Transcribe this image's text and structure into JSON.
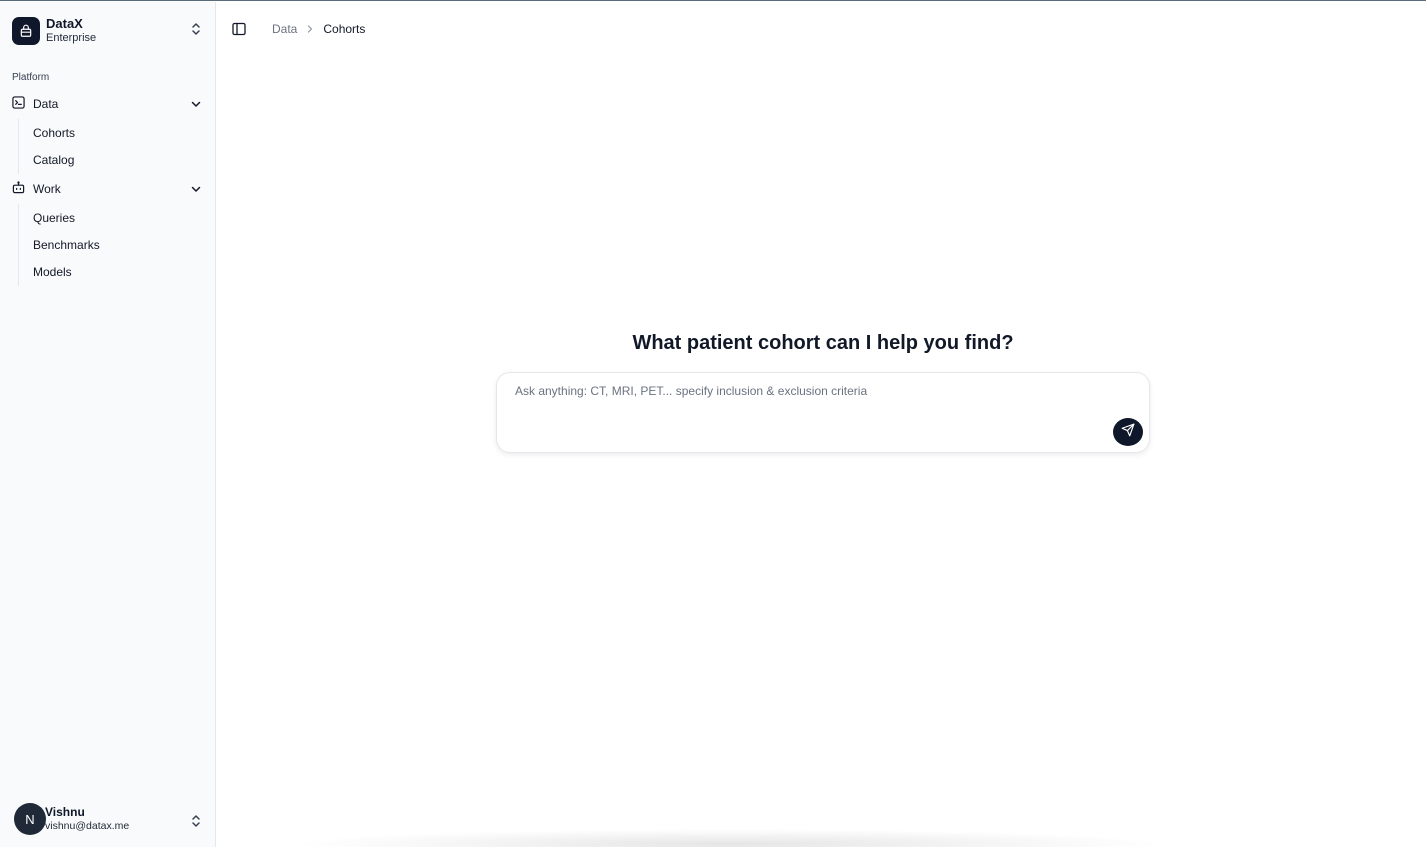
{
  "brand": {
    "name": "DataX",
    "plan": "Enterprise"
  },
  "sidebar": {
    "section_label": "Platform",
    "groups": [
      {
        "label": "Data",
        "icon": "chart-square-icon",
        "items": [
          "Cohorts",
          "Catalog"
        ]
      },
      {
        "label": "Work",
        "icon": "bot-icon",
        "items": [
          "Queries",
          "Benchmarks",
          "Models"
        ]
      }
    ]
  },
  "user": {
    "initial": "N",
    "name": "Vishnu",
    "email": "vishnu@datax.me"
  },
  "breadcrumb": {
    "parent": "Data",
    "current": "Cohorts"
  },
  "main": {
    "title": "What patient cohort can I help you find?",
    "input_placeholder": "Ask anything: CT, MRI, PET... specify inclusion & exclusion criteria",
    "input_value": ""
  },
  "colors": {
    "accent": "#0f172a",
    "sidebar_bg": "#f9fafb",
    "border": "#e5e7eb"
  }
}
